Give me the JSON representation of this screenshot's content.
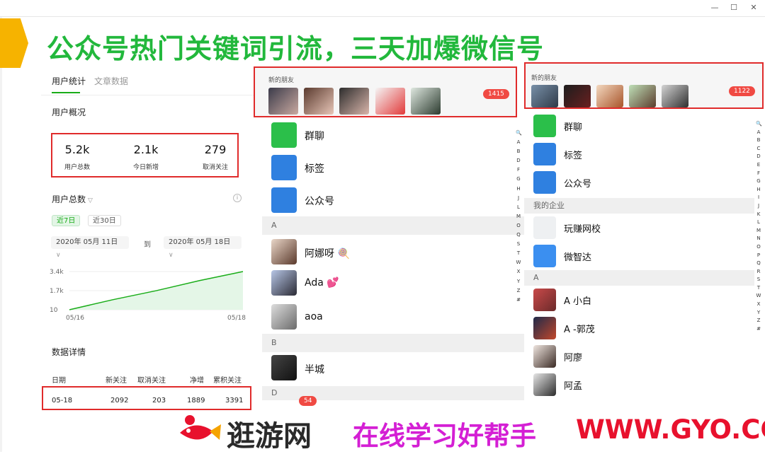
{
  "window": {
    "min": "—",
    "max": "☐",
    "close": "✕"
  },
  "headline": "公众号热门关键词引流，三天加爆微信号",
  "stats_panel": {
    "tabs": [
      "用户统计",
      "文章数据"
    ],
    "overview_title": "用户概况",
    "stats": [
      {
        "value": "5.2k",
        "label": "用户总数"
      },
      {
        "value": "2.1k",
        "label": "今日新增"
      },
      {
        "value": "279",
        "label": "取消关注"
      }
    ],
    "total_title": "用户总数",
    "range_buttons": [
      "近7日",
      "近30日"
    ],
    "date_from": "2020年 05月 11日",
    "to_label": "到",
    "date_to": "2020年 05月 18日",
    "detail_title": "数据详情",
    "table_headers": [
      "日期",
      "新关注",
      "取消关注",
      "净增",
      "累积关注"
    ],
    "table_row": [
      "05-18",
      "2092",
      "203",
      "1889",
      "3391"
    ]
  },
  "chart_data": {
    "type": "area",
    "x": [
      "05/16",
      "05/18"
    ],
    "yticks": [
      "3.4k",
      "1.7k",
      "10"
    ],
    "series": [
      {
        "values": [
          10,
          900,
          1700,
          2600,
          3400
        ]
      }
    ],
    "ylim": [
      10,
      3400
    ],
    "color": "#1aad19"
  },
  "contacts_mid": {
    "new_friends_label": "新的朋友",
    "badge": "1415",
    "items": [
      {
        "label": "群聊",
        "icon": "group-icon"
      },
      {
        "label": "标签",
        "icon": "tag-icon"
      },
      {
        "label": "公众号",
        "icon": "official-account-icon"
      }
    ],
    "section_a": "A",
    "contacts_a": [
      "阿娜呀 🍭",
      "Ada 💕",
      "aoa"
    ],
    "section_b": "B",
    "contacts_b": [
      "半城"
    ],
    "section_d": "D",
    "bottom_badges": [
      "54"
    ],
    "index": [
      "🔍",
      "A",
      "B",
      "D",
      "F",
      "G",
      "H",
      "J",
      "L",
      "M",
      "O",
      "Q",
      "S",
      "T",
      "W",
      "X",
      "Y",
      "Z",
      "#"
    ]
  },
  "contacts_right": {
    "new_friends_label": "新的朋友",
    "badge": "1122",
    "items": [
      {
        "label": "群聊",
        "icon": "group-icon"
      },
      {
        "label": "标签",
        "icon": "tag-icon"
      },
      {
        "label": "公众号",
        "icon": "official-account-icon"
      }
    ],
    "enterprise_section": "我的企业",
    "enterprise": [
      {
        "label": "玩赚网校",
        "icon": "cloud-icon"
      },
      {
        "label": "微智达",
        "icon": "home-icon"
      }
    ],
    "section_a": "A",
    "contacts_a": [
      "A  小白",
      "A -郭茂",
      "阿廖",
      "阿孟"
    ],
    "index": [
      "🔍",
      "A",
      "B",
      "C",
      "D",
      "E",
      "F",
      "G",
      "H",
      "I",
      "J",
      "K",
      "L",
      "M",
      "N",
      "O",
      "P",
      "Q",
      "R",
      "S",
      "T",
      "W",
      "X",
      "Y",
      "Z",
      "#"
    ]
  },
  "watermark": {
    "part1": "逛游网",
    "part2": "在线学习好帮手",
    "part3": "WWW.GYO.CC"
  }
}
